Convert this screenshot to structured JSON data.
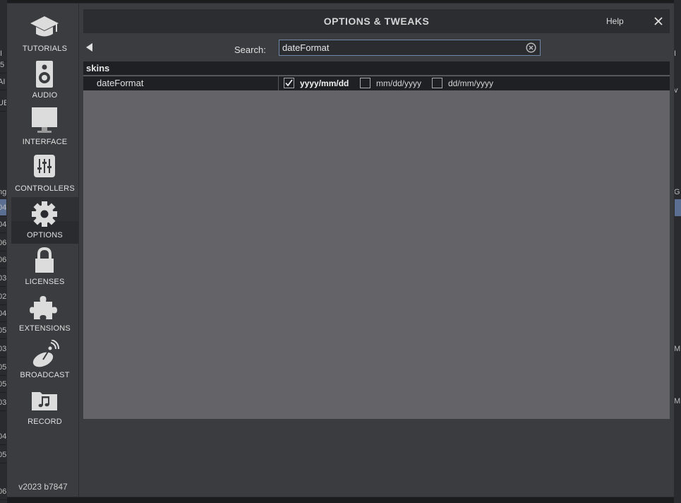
{
  "background": {
    "left_fragments": [
      "II",
      ".5",
      "AI",
      "UE",
      "ng",
      "04",
      "04",
      "06",
      "06",
      "03",
      "02",
      "04",
      "05",
      "03",
      "05",
      "05",
      "03",
      "04",
      "05",
      "06"
    ],
    "right_fragments": [
      "I",
      "v",
      "G",
      "M",
      "M"
    ]
  },
  "sidebar": {
    "items": [
      {
        "label": "TUTORIALS",
        "icon": "graduation-cap-icon"
      },
      {
        "label": "AUDIO",
        "icon": "speaker-icon"
      },
      {
        "label": "INTERFACE",
        "icon": "monitor-icon"
      },
      {
        "label": "CONTROLLERS",
        "icon": "sliders-icon"
      },
      {
        "label": "OPTIONS",
        "icon": "gear-icon",
        "active": true
      },
      {
        "label": "LICENSES",
        "icon": "lock-icon"
      },
      {
        "label": "EXTENSIONS",
        "icon": "puzzle-icon"
      },
      {
        "label": "BROADCAST",
        "icon": "satellite-dish-icon"
      },
      {
        "label": "RECORD",
        "icon": "music-folder-icon"
      }
    ],
    "version": "v2023 b7847"
  },
  "header": {
    "title": "OPTIONS & TWEAKS",
    "help_label": "Help"
  },
  "search": {
    "label": "Search:",
    "value": "dateFormat"
  },
  "section": {
    "title": "skins",
    "option": {
      "name": "dateFormat",
      "choices": [
        {
          "label": "yyyy/mm/dd",
          "checked": true
        },
        {
          "label": "mm/dd/yyyy",
          "checked": false
        },
        {
          "label": "dd/mm/yyyy",
          "checked": false
        }
      ]
    }
  },
  "colors": {
    "panel": "#636368",
    "dialog": "#3b3c3f",
    "row": "#1f2023",
    "search_border": "#6e88a8"
  }
}
